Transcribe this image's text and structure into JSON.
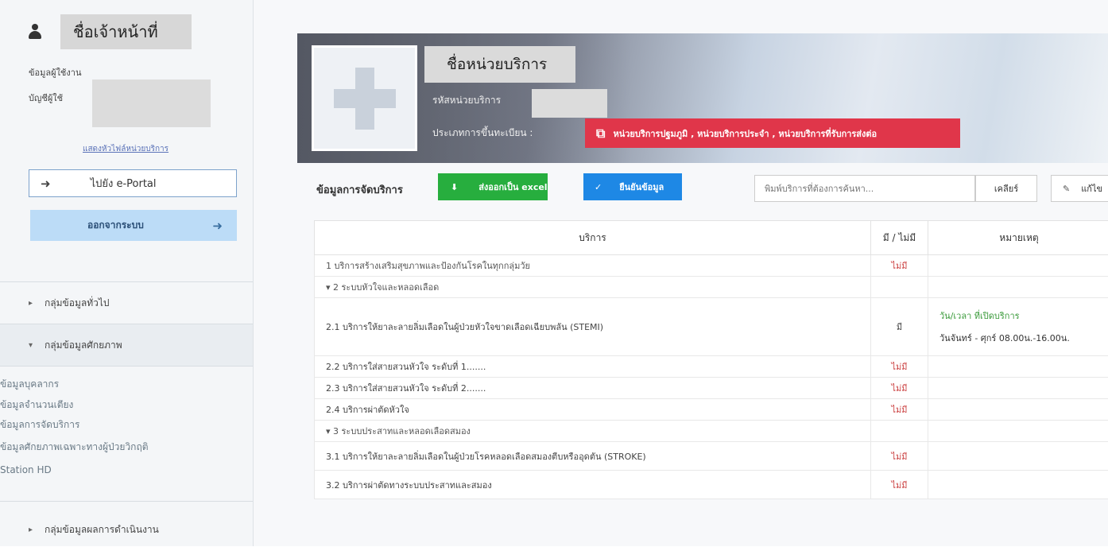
{
  "sidebar": {
    "user_name": "ชื่อเจ้าหน้าที่",
    "user_info_label": "ข้อมูลผู้ใช้งาน",
    "account_label": "บัญชีผู้ใช้",
    "change_unit_link": "แสดงหัวไฟล์หน่วยบริการ",
    "eportal_label": "ไปยัง e-Portal",
    "logout_label": "ออกจากระบบ",
    "groups": [
      {
        "label": "กลุ่มข้อมูลทั่วไป",
        "open": false
      },
      {
        "label": "กลุ่มข้อมูลศักยภาพ",
        "open": true
      },
      {
        "label": "กลุ่มข้อมูลผลการดำเนินงาน",
        "open": false
      }
    ],
    "sub_items": [
      "ข้อมูลบุคลากร",
      "ข้อมูลจำนวนเตียง",
      "ข้อมูลการจัดบริการ",
      "ข้อมูลศักยภาพเฉพาะทางผู้ป่วยวิกฤติ",
      "Station HD"
    ]
  },
  "banner": {
    "unit_name": "ชื่อหน่วยบริการ",
    "unit_code_label": "รหัสหน่วยบริการ",
    "reg_type_label": "ประเภทการขึ้นทะเบียน :",
    "reg_types": "หน่วยบริการปฐมภูมิ , หน่วยบริการประจำ , หน่วยบริการที่รับการส่งต่อ"
  },
  "toolbar": {
    "title": "ข้อมูลการจัดบริการ",
    "export_label": "ส่งออกเป็น excel",
    "confirm_label": "ยืนยันข้อมูล",
    "search_placeholder": "พิมพ์บริการที่ต้องการค้นหา...",
    "clear_label": "เคลียร์",
    "edit_label": "แก้ไข"
  },
  "table": {
    "headers": [
      "บริการ",
      "มี / ไม่มี",
      "หมายเหตุ"
    ],
    "rows": [
      {
        "name": "1 บริการสร้างเสริมสุขภาพและป้องกันโรคในทุกกลุ่มวัย",
        "avail": "ไม่มี"
      },
      {
        "name": "2 ระบบหัวใจและหลอดเลือด",
        "avail": ""
      },
      {
        "name": "2.1 บริการให้ยาละลายลิ่มเลือดในผู้ป่วยหัวใจขาดเลือดเฉียบพลัน (STEMI)",
        "avail": "มี",
        "remark_label": "วัน/เวลา ที่เปิดบริการ",
        "remark_value": "วันจันทร์ - ศุกร์ 08.00น.-16.00น."
      },
      {
        "name": "2.2 บริการใส่สายสวนหัวใจ ระดับที่ 1.......",
        "avail": "ไม่มี"
      },
      {
        "name": "2.3 บริการใส่สายสวนหัวใจ ระดับที่ 2.......",
        "avail": "ไม่มี"
      },
      {
        "name": "2.4 บริการผ่าตัดหัวใจ",
        "avail": "ไม่มี"
      },
      {
        "name": "3 ระบบประสาทและหลอดเลือดสมอง",
        "avail": ""
      },
      {
        "name": "3.1 บริการให้ยาละลายลิ่มเลือดในผู้ป่วยโรคหลอดเลือดสมองตีบหรืออุดตัน (STROKE)",
        "avail": "ไม่มี"
      },
      {
        "name": "3.2 บริการผ่าตัดทางระบบประสาทและสมอง",
        "avail": "ไม่มี"
      }
    ]
  }
}
